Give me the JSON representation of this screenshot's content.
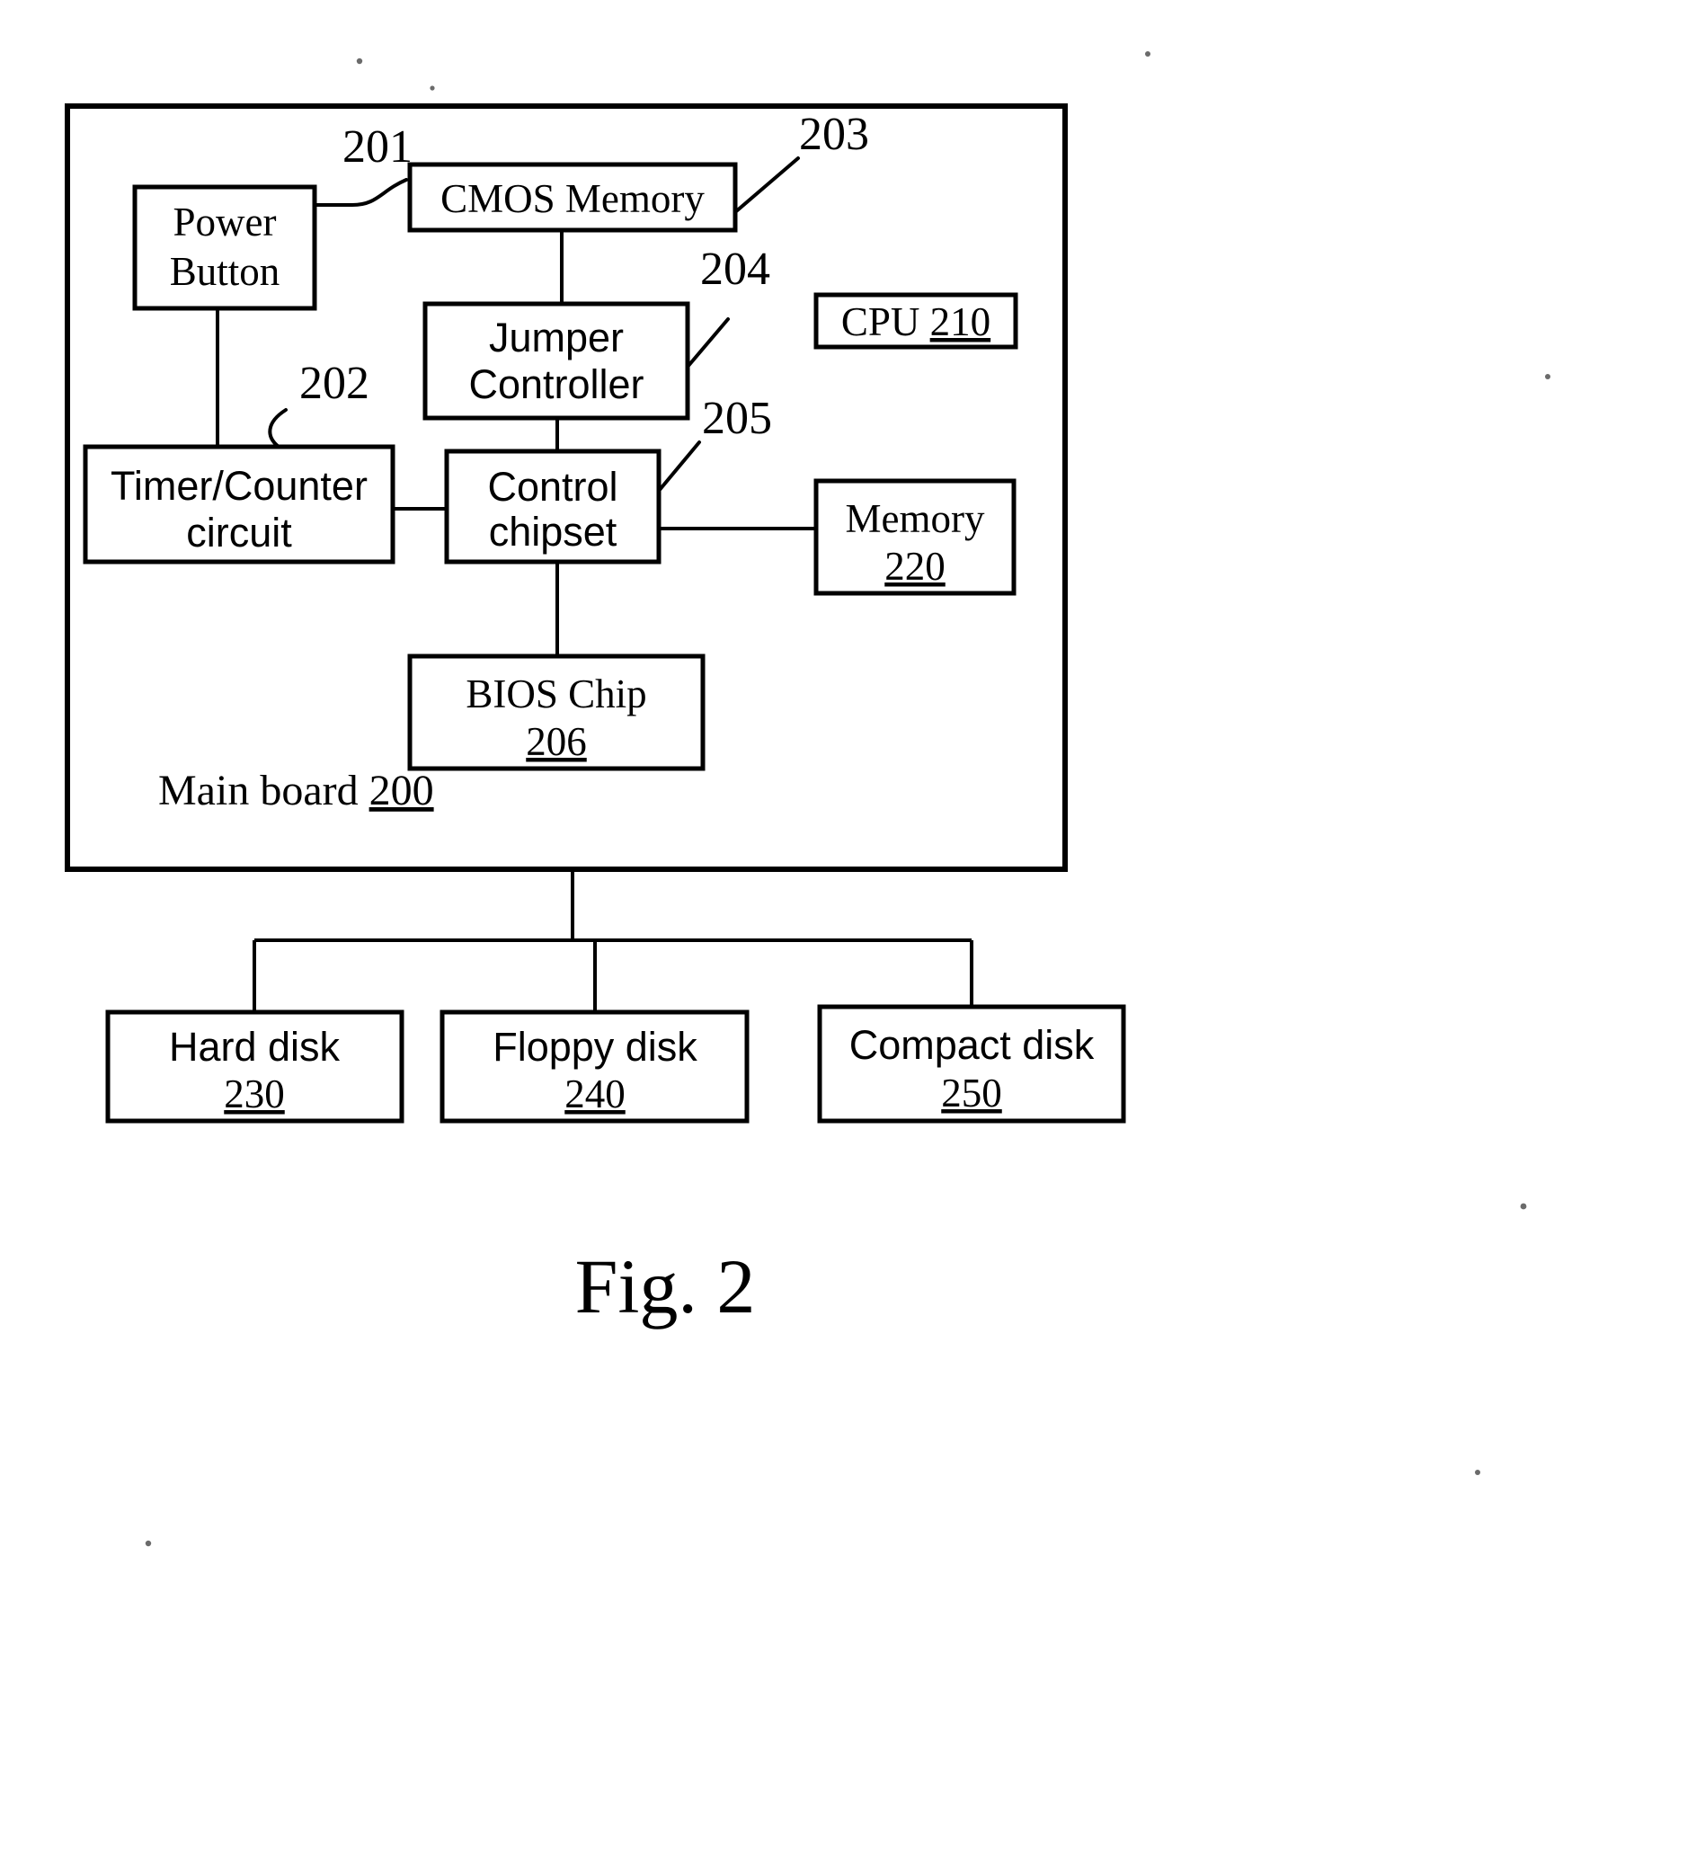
{
  "figure": {
    "caption": "Fig. 2",
    "board_label_text": "Main board ",
    "board_label_ref": "200"
  },
  "blocks": {
    "power_button": {
      "line1": "Power",
      "line2": "Button",
      "ref": "201"
    },
    "cmos_memory": {
      "line1": "CMOS Memory",
      "ref": "203"
    },
    "jumper_controller": {
      "line1": "Jumper",
      "line2": "Controller",
      "ref": "204"
    },
    "cpu": {
      "line1": "CPU ",
      "ref": "210"
    },
    "timer_counter": {
      "line1": "Timer/Counter",
      "line2": "circuit",
      "ref": "202"
    },
    "control_chipset": {
      "line1": "Control",
      "line2": "chipset",
      "ref": "205"
    },
    "memory": {
      "line1": "Memory",
      "ref": "220"
    },
    "bios_chip": {
      "line1": "BIOS Chip",
      "ref": "206"
    },
    "hard_disk": {
      "line1": "Hard disk",
      "ref": "230"
    },
    "floppy_disk": {
      "line1": "Floppy disk",
      "ref": "240"
    },
    "compact_disk": {
      "line1": "Compact disk",
      "ref": "250"
    }
  },
  "chart_data": {
    "type": "diagram",
    "title": "Fig. 2",
    "nodes": [
      {
        "id": "200",
        "label": "Main board 200",
        "kind": "container"
      },
      {
        "id": "201",
        "label": "Power Button",
        "kind": "block"
      },
      {
        "id": "202",
        "label": "Timer/Counter circuit",
        "kind": "block"
      },
      {
        "id": "203",
        "label": "CMOS Memory",
        "kind": "block"
      },
      {
        "id": "204",
        "label": "Jumper Controller",
        "kind": "block"
      },
      {
        "id": "205",
        "label": "Control chipset",
        "kind": "block"
      },
      {
        "id": "206",
        "label": "BIOS Chip 206",
        "kind": "block"
      },
      {
        "id": "210",
        "label": "CPU 210",
        "kind": "block"
      },
      {
        "id": "220",
        "label": "Memory 220",
        "kind": "block"
      },
      {
        "id": "230",
        "label": "Hard disk 230",
        "kind": "block"
      },
      {
        "id": "240",
        "label": "Floppy disk 240",
        "kind": "block"
      },
      {
        "id": "250",
        "label": "Compact disk 250",
        "kind": "block"
      }
    ],
    "edges": [
      {
        "from": "201",
        "to": "202"
      },
      {
        "from": "203",
        "to": "204"
      },
      {
        "from": "204",
        "to": "205"
      },
      {
        "from": "202",
        "to": "205"
      },
      {
        "from": "205",
        "to": "220"
      },
      {
        "from": "205",
        "to": "206"
      },
      {
        "from": "200",
        "to": "230"
      },
      {
        "from": "200",
        "to": "240"
      },
      {
        "from": "200",
        "to": "250"
      }
    ]
  },
  "colors": {
    "ink": "#000000",
    "paper": "#ffffff"
  }
}
